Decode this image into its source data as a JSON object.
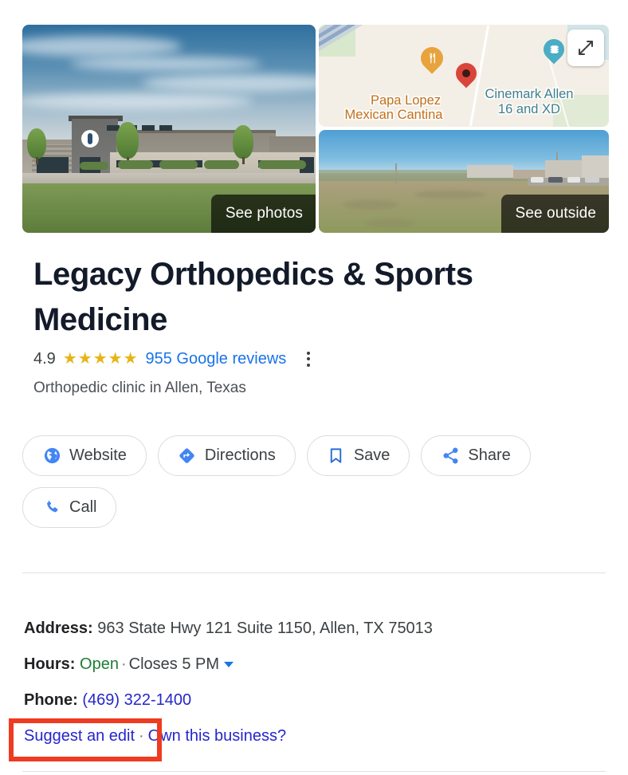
{
  "media": {
    "main_photo": {
      "alt": "Legacy Orthopedics building exterior",
      "badge": "See photos"
    },
    "street_view": {
      "alt": "Street view of field near the clinic",
      "badge": "See outside"
    },
    "map": {
      "expand_label": "Expand map",
      "labels": [
        {
          "text": "Papa Lopez",
          "kind": "restaurant"
        },
        {
          "text": "Mexican Cantina",
          "kind": "restaurant"
        },
        {
          "text": "Cinemark Allen",
          "kind": "cinema"
        },
        {
          "text": "16 and XD",
          "kind": "cinema"
        }
      ],
      "pins": [
        {
          "name": "restaurant-pin",
          "icon": "fork-knife-icon"
        },
        {
          "name": "place-pin",
          "icon": "location-pin-icon"
        },
        {
          "name": "cinema-pin",
          "icon": "film-icon"
        }
      ]
    }
  },
  "business": {
    "name": "Legacy Orthopedics & Sports Medicine",
    "rating": "4.9",
    "stars": 5,
    "star_glyph": "★",
    "reviews_label": "955 Google reviews",
    "category": "Orthopedic clinic in Allen, Texas"
  },
  "actions": [
    {
      "label": "Website",
      "icon": "globe-icon"
    },
    {
      "label": "Directions",
      "icon": "directions-icon"
    },
    {
      "label": "Save",
      "icon": "bookmark-icon"
    },
    {
      "label": "Share",
      "icon": "share-icon"
    },
    {
      "label": "Call",
      "icon": "phone-icon"
    }
  ],
  "info": {
    "address_label": "Address:",
    "address_value": "963 State Hwy 121 Suite 1150, Allen, TX 75013",
    "hours_label": "Hours:",
    "hours_status": "Open",
    "hours_separator": "·",
    "hours_closes": "Closes 5 PM",
    "phone_label": "Phone:",
    "phone_value": "(469) 322-1400"
  },
  "footer": {
    "suggest_edit": "Suggest an edit",
    "separator": "·",
    "own_business": "Own this business?"
  },
  "colors": {
    "link_blue": "#1a73e8",
    "visited_purple": "#2626cc",
    "open_green": "#1e7e34",
    "star_gold": "#e7b416",
    "annotation_red": "#ef3b21",
    "title_navy": "#131a29"
  }
}
